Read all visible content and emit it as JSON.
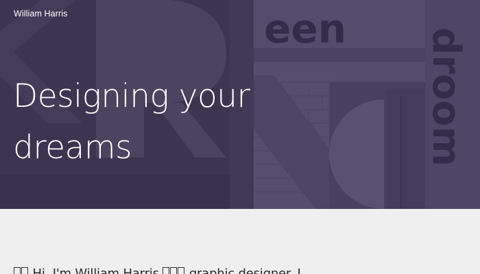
{
  "header": {
    "site_name": "William Harris"
  },
  "hero": {
    "title_line1": "Designing your",
    "title_line2": "dreams",
    "background_words": [
      "een",
      "droom"
    ],
    "overlay_color": "#3a2e52"
  },
  "intro": {
    "text_part1": "Hi, I'm William Harris,",
    "text_part2": "graphic designer. I"
  }
}
